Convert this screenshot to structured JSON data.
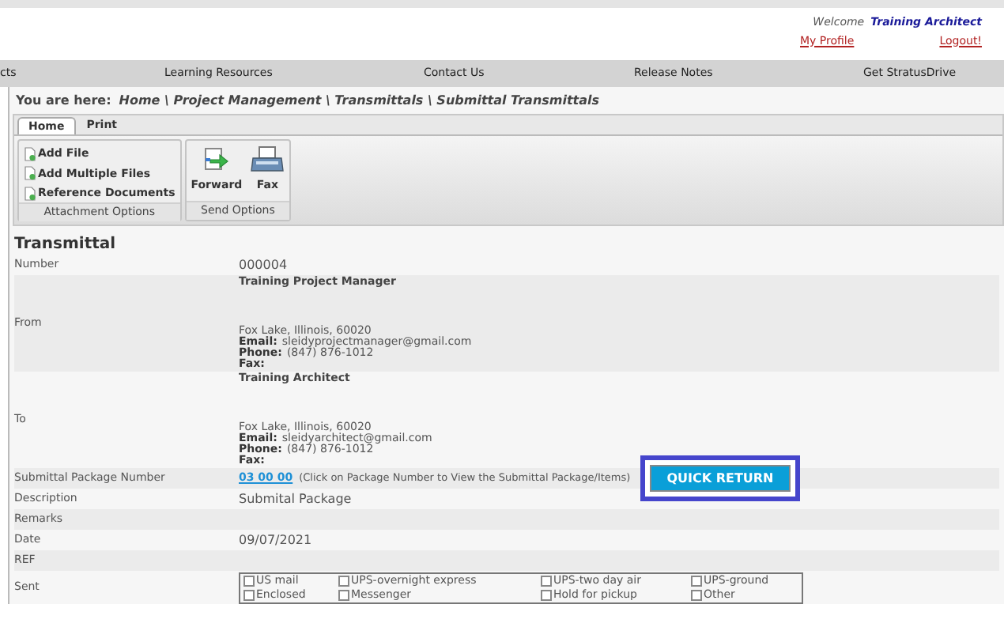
{
  "header": {
    "welcome_label": "Welcome",
    "user": "Training Architect",
    "links": [
      "My Profile",
      "Logout!"
    ]
  },
  "nav": [
    "cts",
    "Learning Resources",
    "Contact Us",
    "Release Notes",
    "Get StratusDrive"
  ],
  "breadcrumb": {
    "label": "You are here:",
    "path": "Home \\ Project Management \\ Transmittals \\ Submittal Transmittals"
  },
  "ribbon": {
    "tabs": [
      {
        "label": "Home",
        "selected": true
      },
      {
        "label": "Print",
        "selected": false
      }
    ],
    "groups": [
      {
        "title": "Attachment Options",
        "kind": "list",
        "items": [
          "Add File",
          "Add Multiple Files",
          "Reference Documents"
        ]
      },
      {
        "title": "Send Options",
        "kind": "large",
        "items": [
          "Forward",
          "Fax"
        ]
      }
    ]
  },
  "section_title": "Transmittal",
  "fields": [
    {
      "label": "Number",
      "kind": "text",
      "value": "000004"
    },
    {
      "label": "From",
      "kind": "contact",
      "name": "Training Project Manager",
      "address": "Fox Lake, Illinois, 60020",
      "lines": [
        {
          "label": "Email:",
          "value": "sleidyprojectmanager@gmail.com"
        },
        {
          "label": "Phone:",
          "value": "(847) 876-1012"
        },
        {
          "label": "Fax:"
        }
      ]
    },
    {
      "label": "To",
      "kind": "contact",
      "name": "Training Architect",
      "address": "Fox Lake, Illinois, 60020",
      "lines": [
        {
          "label": "Email:",
          "value": "sleidyarchitect@gmail.com"
        },
        {
          "label": "Phone:",
          "value": "(847) 876-1012"
        },
        {
          "label": "Fax:"
        }
      ]
    },
    {
      "label": "Submittal Package Number",
      "kind": "package",
      "link": "03 00 00",
      "note": "(Click on Package Number to View the Submittal Package/Items)",
      "button": "QUICK RETURN",
      "highlighted": true
    },
    {
      "label": "Description",
      "kind": "text",
      "value": "Submital Package"
    },
    {
      "label": "Remarks",
      "kind": "text"
    },
    {
      "label": "Date",
      "kind": "text",
      "value": "09/07/2021"
    },
    {
      "label": "REF",
      "kind": "text"
    },
    {
      "label": "Sent",
      "kind": "checks",
      "options": [
        {
          "label": "US mail",
          "checked": false
        },
        {
          "label": "UPS-overnight express",
          "checked": false
        },
        {
          "label": "UPS-two day air",
          "checked": false
        },
        {
          "label": "UPS-ground",
          "checked": false
        },
        {
          "label": "Enclosed",
          "checked": false
        },
        {
          "label": "Messenger",
          "checked": false
        },
        {
          "label": "Hold for pickup",
          "checked": false
        },
        {
          "label": "Other",
          "checked": false
        }
      ]
    }
  ]
}
